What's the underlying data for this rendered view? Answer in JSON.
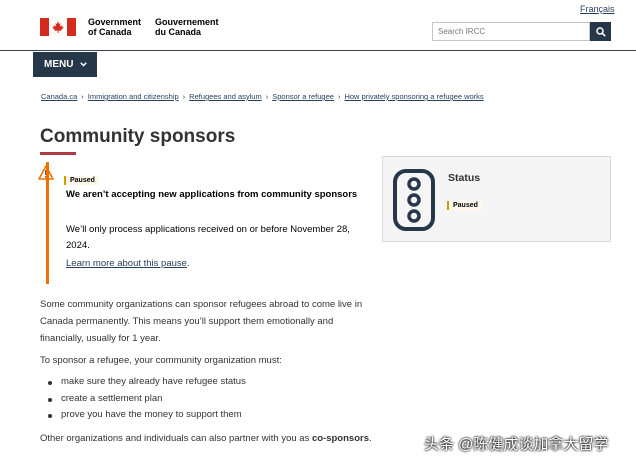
{
  "header": {
    "language_link": "Français",
    "signature_en_line1": "Government",
    "signature_en_line2": "of Canada",
    "signature_fr_line1": "Gouvernement",
    "signature_fr_line2": "du Canada",
    "search_placeholder": "Search IRCC",
    "flag_icon": "canada-flag-icon",
    "search_icon": "search-icon"
  },
  "menu": {
    "label": "MENU"
  },
  "breadcrumb": [
    "Canada.ca",
    "Immigration and citizenship",
    "Refugees and asylum",
    "Sponsor a refugee",
    "How privately sponsoring a refugee works"
  ],
  "page_title": "Community sponsors",
  "alert": {
    "badge": "Paused",
    "heading": "We aren’t accepting new applications from community sponsors",
    "body": "We’ll only process applications received on or before November 28, 2024.",
    "link_text": "Learn more about this pause",
    "link_suffix": ".",
    "icon": "warning-icon"
  },
  "status_card": {
    "title": "Status",
    "badge": "Paused",
    "icon": "traffic-light-icon"
  },
  "content": {
    "p1": "Some community organizations can sponsor refugees abroad to come live in Canada permanently. This means you’ll support them emotionally and financially, usually for 1 year.",
    "p2": "To sponsor a refugee, your community organization must:",
    "bullets": [
      "make sure they already have refugee status",
      "create a settlement plan",
      "prove you have the money to support them"
    ],
    "p3_prefix": "Other organizations and individuals can also partner with you as ",
    "p3_bold": "co-sponsors",
    "p3_suffix": "."
  },
  "watermark": "头条 @陈健成谈加拿大留学",
  "colors": {
    "navy": "#26374a",
    "link": "#284162",
    "title_rule": "#af3c43",
    "alert_border": "#ee7100",
    "flag_red": "#d52b1e"
  }
}
